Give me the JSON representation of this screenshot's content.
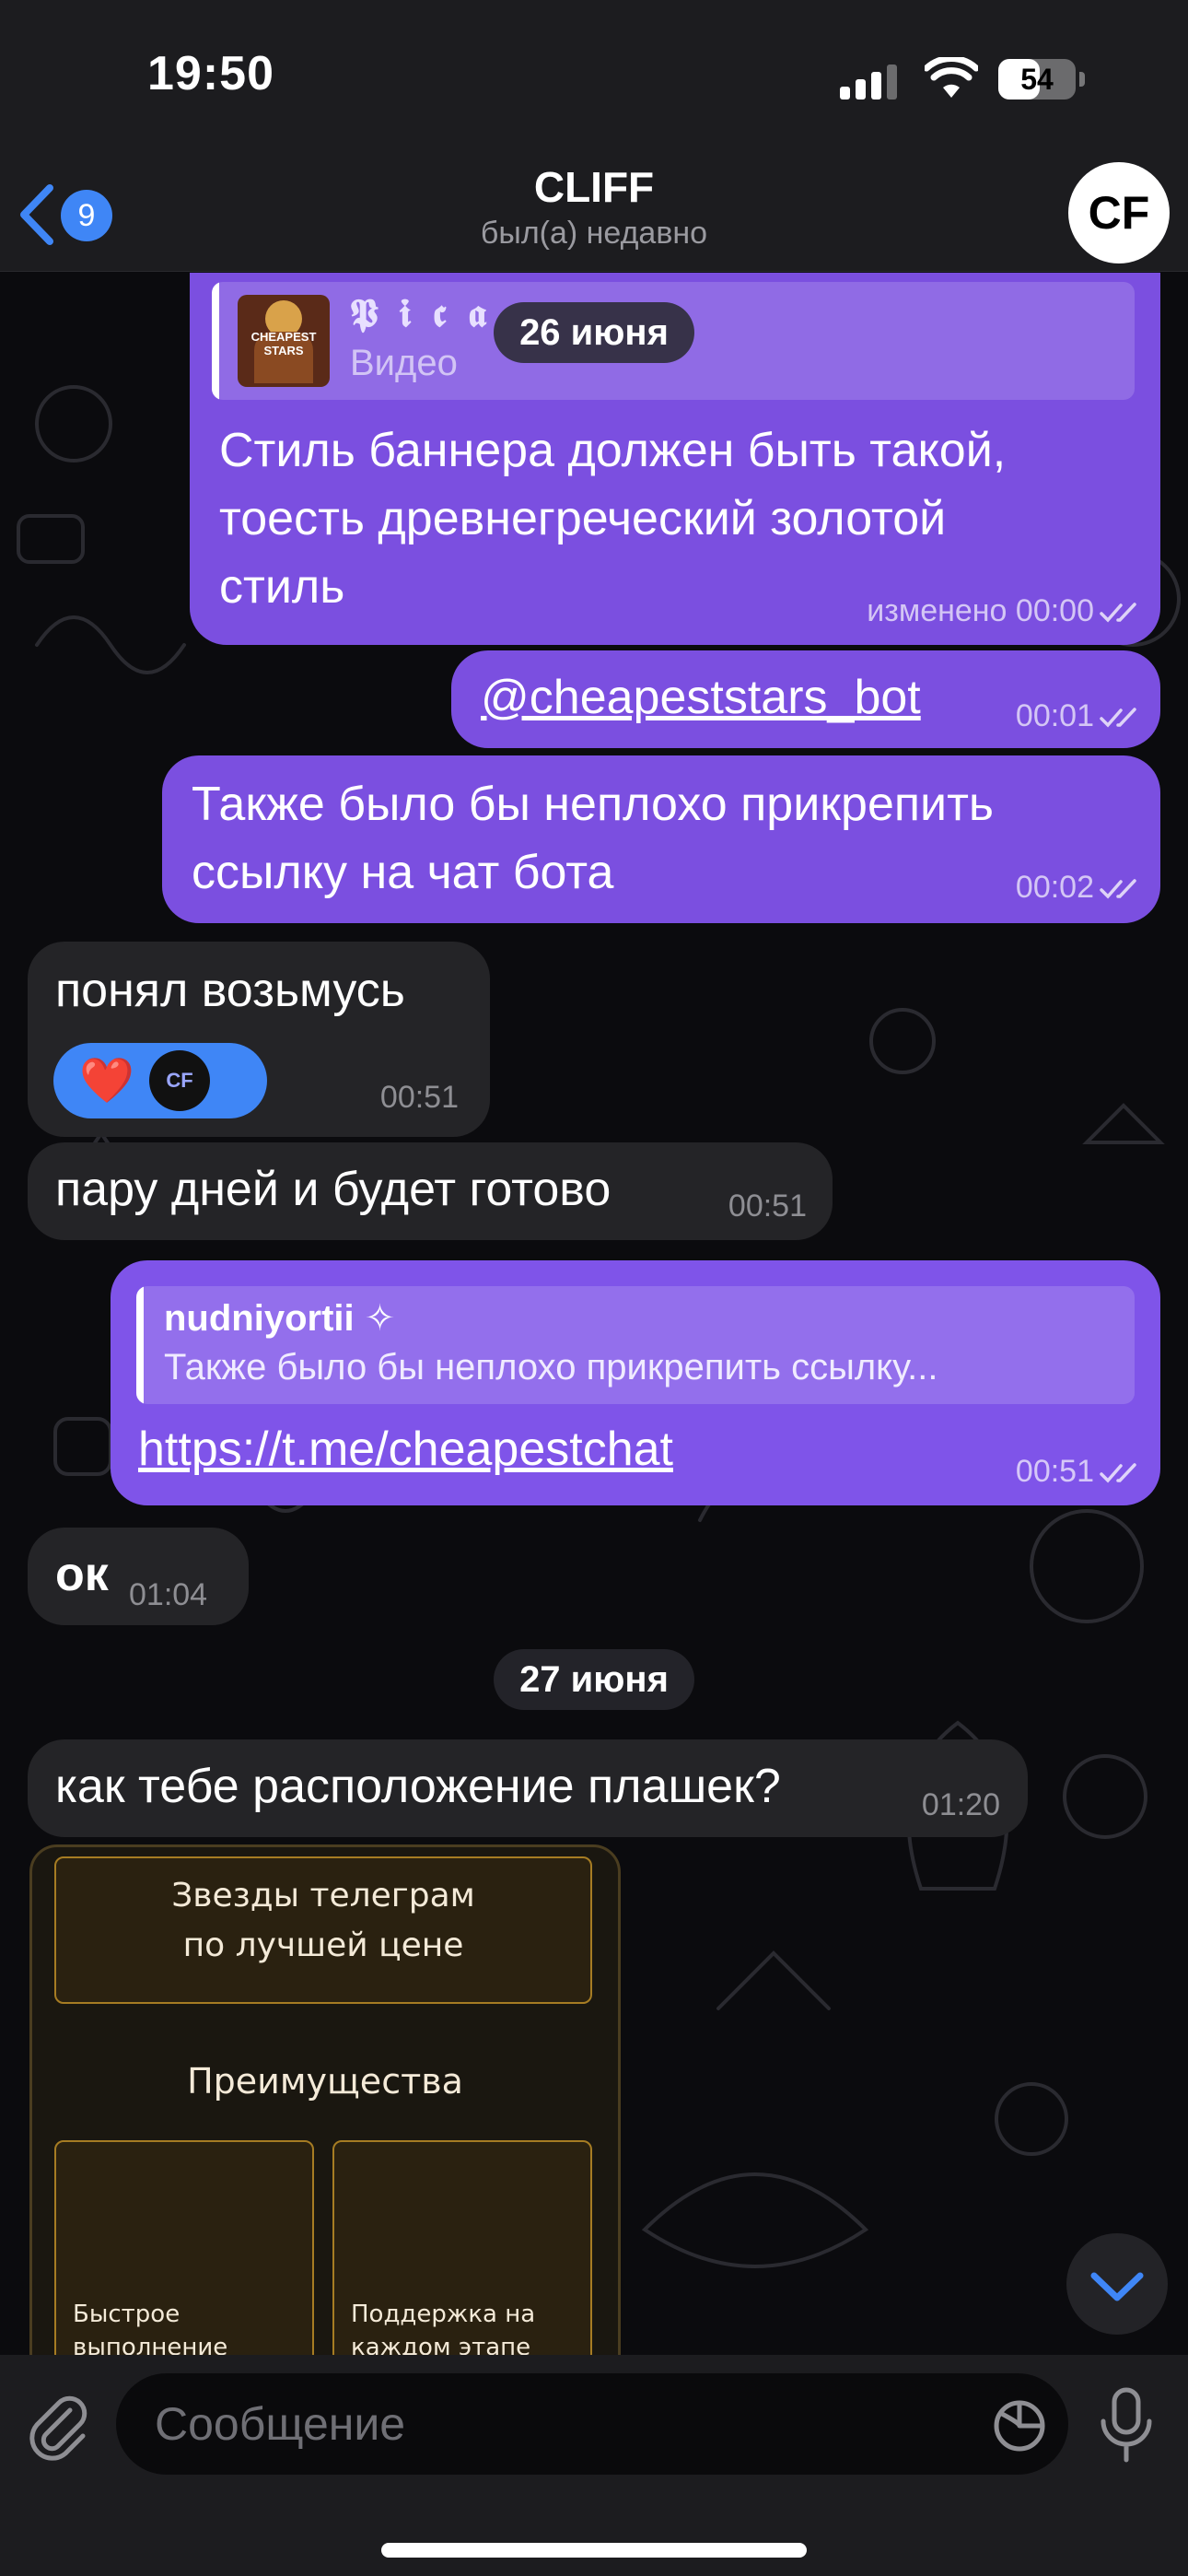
{
  "status_bar": {
    "time": "19:50",
    "battery_percent": "54",
    "battery_level": 0.54
  },
  "header": {
    "back_count": "9",
    "title": "CLIFF",
    "subtitle": "был(а) недавно",
    "avatar_text": "CF"
  },
  "messages": [
    {
      "direction": "out",
      "reply_author": "𝕻 𝖎 𝖈 𝖆",
      "reply_kind": "Видео",
      "thumb_text": "CHEAPEST STARS",
      "text_line1": "Стиль баннера должен быть такой,",
      "text_line2": "тоесть древнегреческий золотой",
      "text_line3": "стиль",
      "meta": "изменено 00:00"
    },
    {
      "direction": "out",
      "text": "@cheapeststars_bot",
      "time": "00:01"
    },
    {
      "direction": "out",
      "text_line1": "Также было бы неплохо прикрепить",
      "text_line2": "ссылку на чат бота",
      "time": "00:02"
    },
    {
      "direction": "in",
      "text": "понял возьмусь",
      "time": "00:51",
      "reaction": "❤️",
      "reaction_avatar": "CF"
    },
    {
      "direction": "in",
      "text": "пару дней и будет готово",
      "time": "00:51"
    },
    {
      "direction": "out",
      "reply_author": "nudniyortii ✧",
      "reply_text": "Также было бы неплохо прикрепить ссылку...",
      "text": "https://t.me/cheapestchat",
      "time": "00:51"
    },
    {
      "direction": "in",
      "text": "ок",
      "time": "01:04"
    },
    {
      "direction": "in",
      "text": "как тебе расположение плашек?",
      "time": "01:20"
    }
  ],
  "date_separators": [
    "26 июня",
    "27 июня"
  ],
  "banner_image": {
    "headline_line1": "Звезды телеграм",
    "headline_line2": "по лучшей цене",
    "section_title": "Преимущества",
    "card1_line1": "Быстрое",
    "card1_line2": "выполнение",
    "card2_line1": "Поддержка на",
    "card2_line2": "каждом этапе"
  },
  "composer": {
    "placeholder": "Сообщение"
  },
  "colors": {
    "outgoing_bubble": "#7b4fe0",
    "incoming_bubble": "#242427",
    "accent_blue": "#3f86f6",
    "banner_gold": "#a67c23"
  }
}
